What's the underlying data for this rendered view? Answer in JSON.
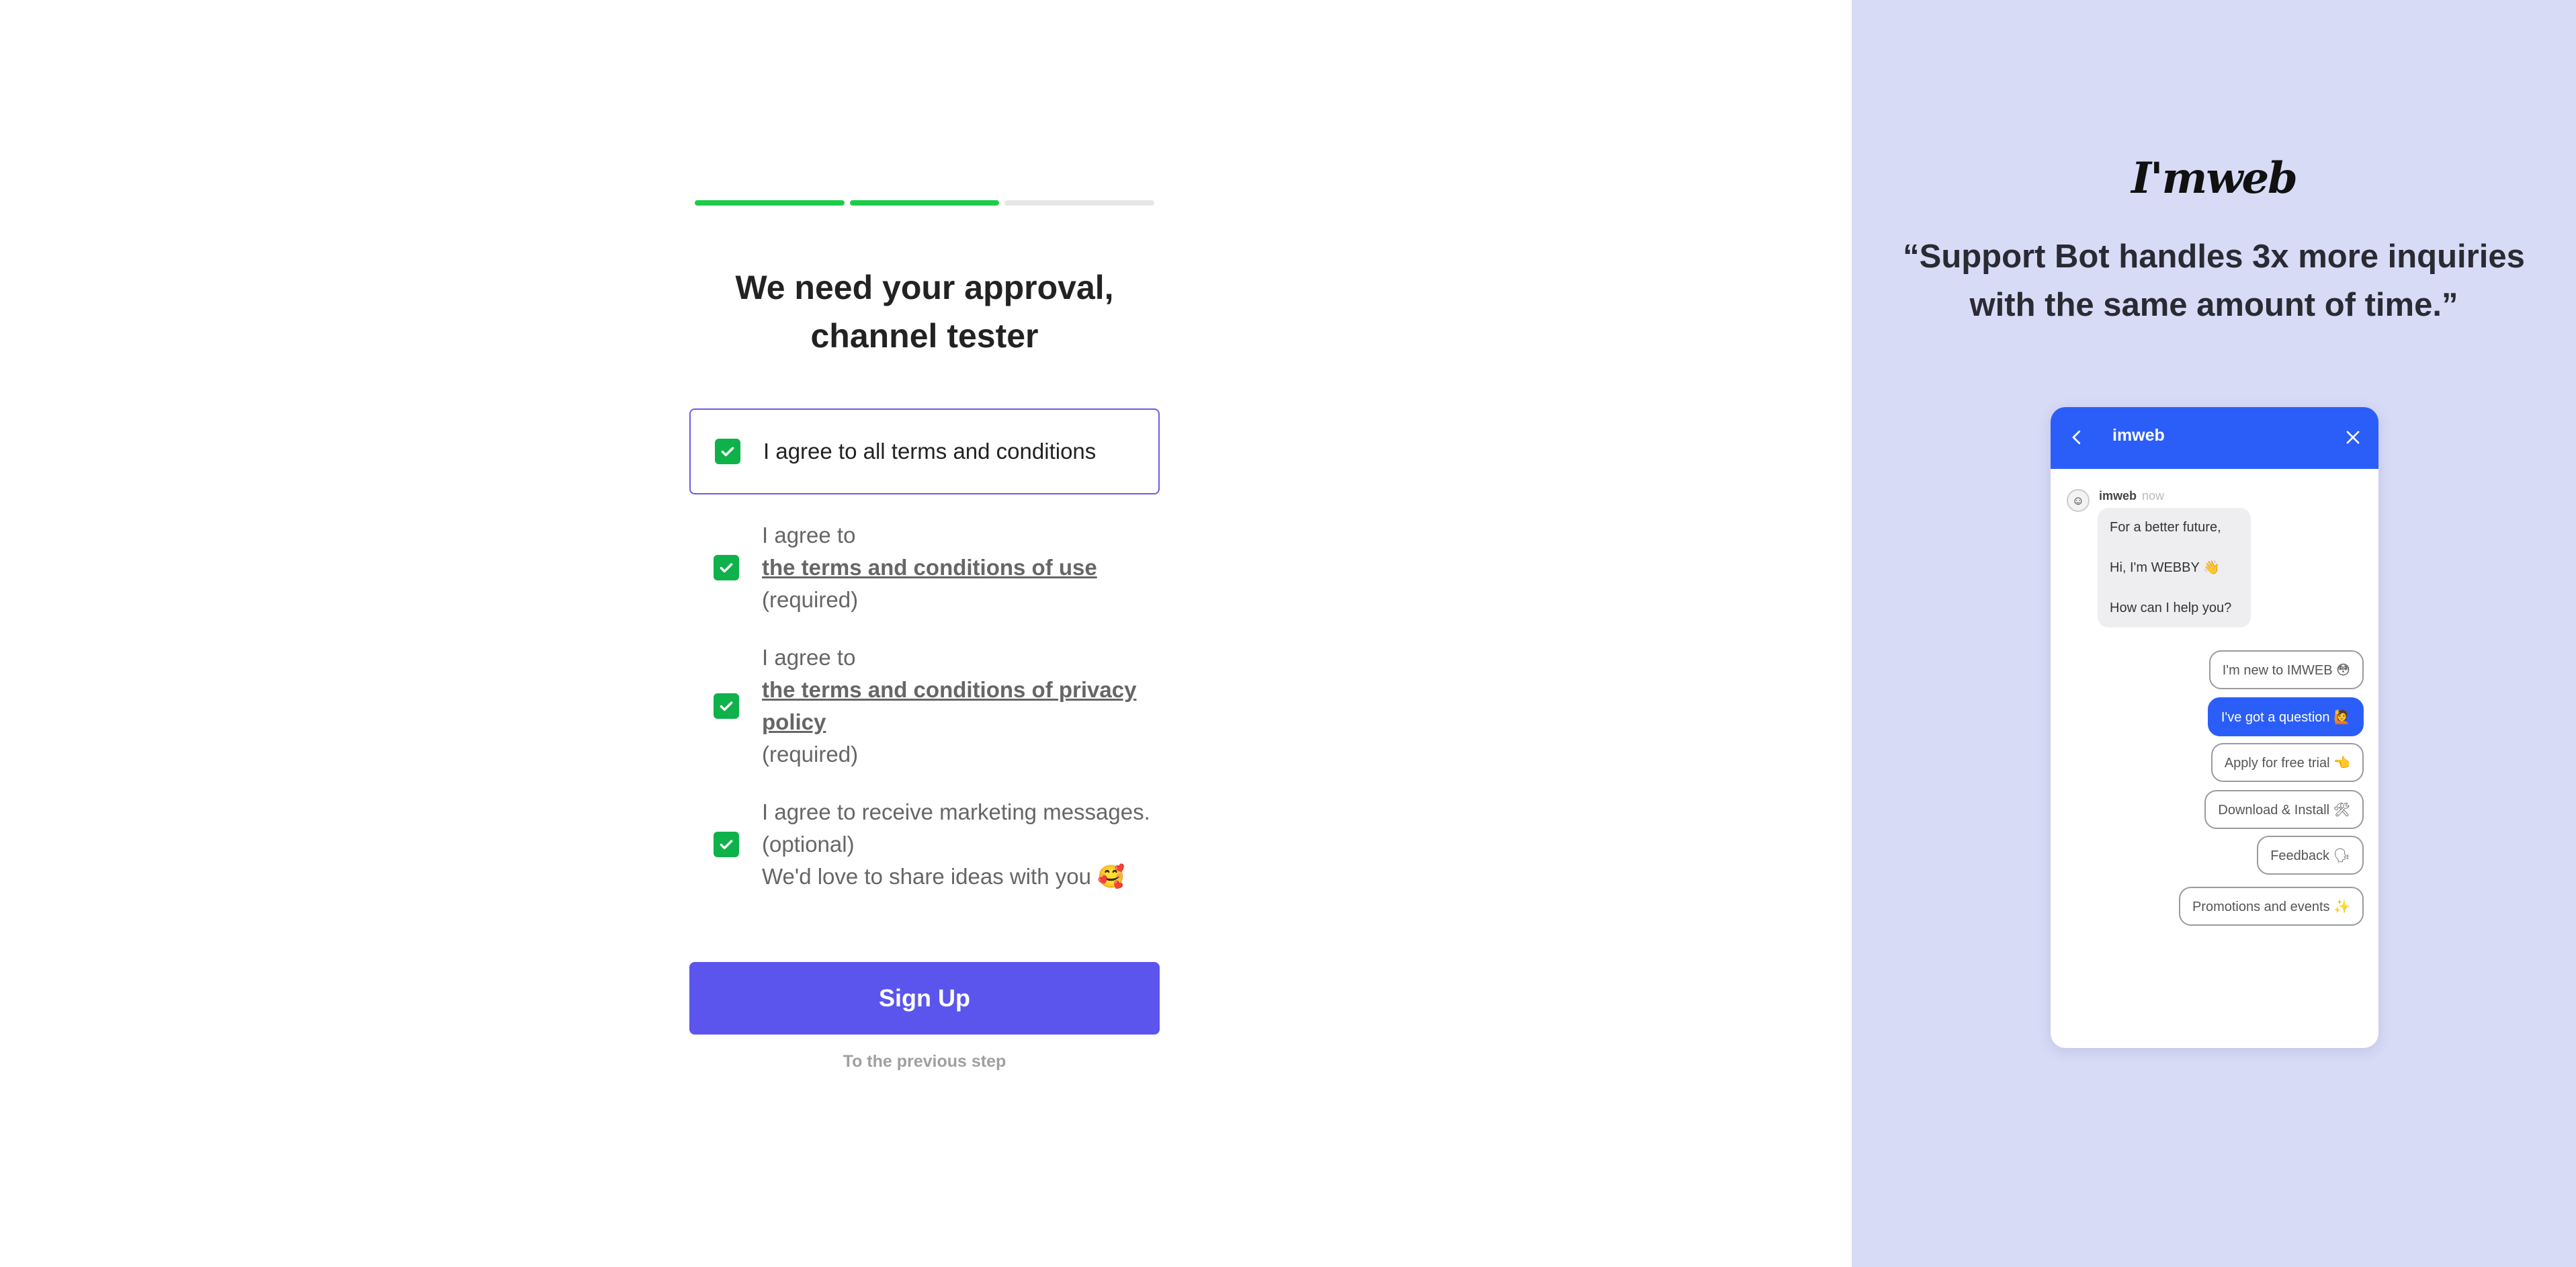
{
  "form": {
    "title": "We need your approval,\nchannel tester",
    "agree_all_label": "I agree to all terms and conditions",
    "terms": [
      {
        "prefix": "I agree to",
        "link": "the terms and conditions of use",
        "suffix": "(required)"
      },
      {
        "prefix": "I agree to",
        "link": "the terms and conditions of privacy policy",
        "suffix": "(required)"
      },
      {
        "prefix": "I agree to receive marketing messages. (optional)",
        "link": "",
        "suffix": "We'd love to share ideas with you 🥰"
      }
    ],
    "signup_label": "Sign Up",
    "previous_label": "To the previous step",
    "progress": {
      "steps_total": 3,
      "steps_done": 2
    }
  },
  "promo": {
    "logo": "I'mweb",
    "quote": "“Support Bot handles 3x more inquiries\nwith the same amount of time.”",
    "chat": {
      "header_title": "imweb",
      "bot_name": "imweb",
      "bot_time": "now",
      "messages": [
        "For a better future,",
        "Hi, I'm WEBBY 👋",
        "How can I help you?"
      ],
      "options": [
        {
          "label": "I'm new to IMWEB 😳",
          "active": false
        },
        {
          "label": "I've got a question 🙋",
          "active": true
        },
        {
          "label": "Apply for free trial 👈",
          "active": false
        },
        {
          "label": "Download & Install 🛠",
          "active": false
        },
        {
          "label": "Feedback 🗣",
          "active": false
        },
        {
          "label": "Promotions and events ✨",
          "active": false
        }
      ]
    }
  },
  "colors": {
    "accent": "#5b55ee",
    "progress_done": "#1dcd48",
    "checkbox": "#0fb24a",
    "right_bg": "#d7dbf6",
    "chat_blue": "#2b5ef8"
  }
}
